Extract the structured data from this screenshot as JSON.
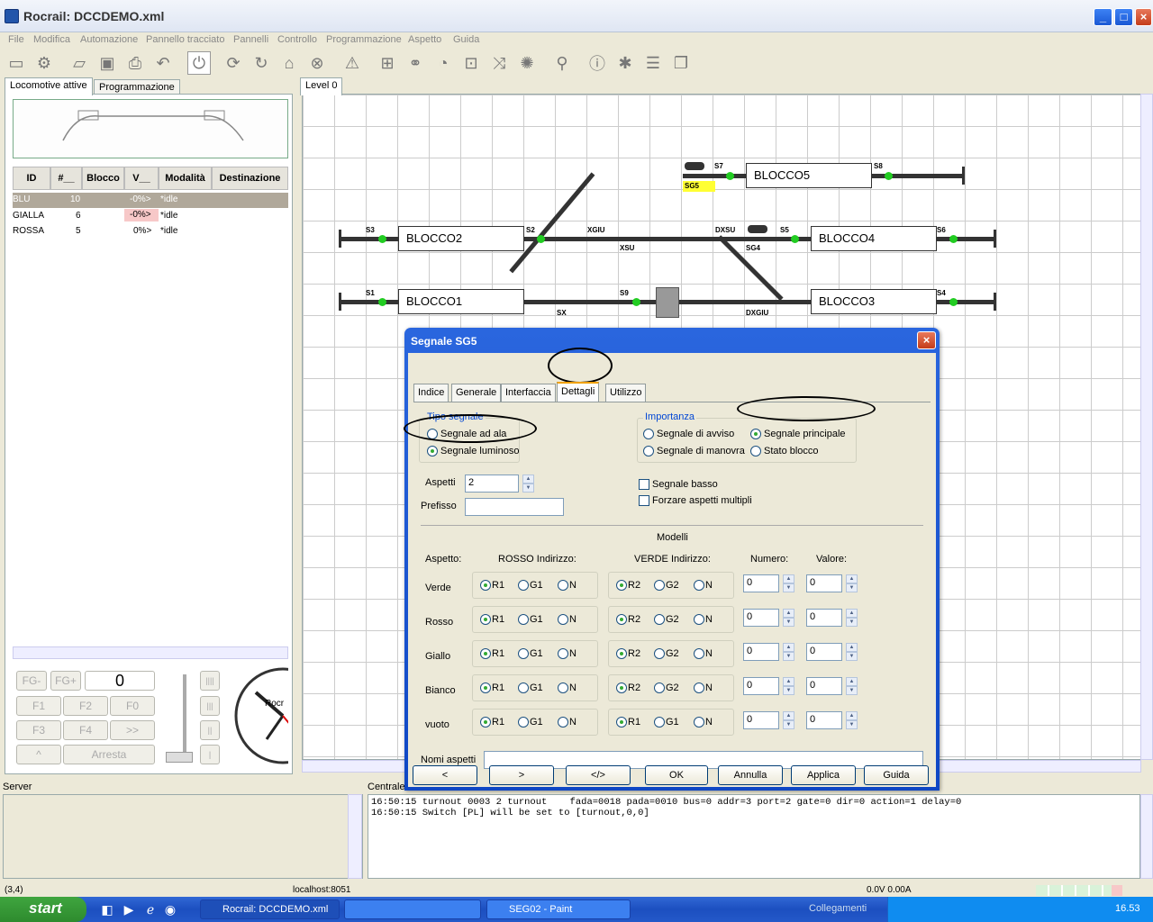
{
  "window": {
    "title": "Rocrail: DCCDEMO.xml"
  },
  "menu": [
    "File",
    "Modifica",
    "Automazione",
    "Pannello tracciato",
    "Pannelli",
    "Controllo",
    "Programmazione",
    "Aspetto",
    "Guida"
  ],
  "left_tabs": [
    "Locomotive attive",
    "Programmazione"
  ],
  "loco_table": {
    "headers": [
      "ID",
      "#__",
      "Blocco",
      "V__",
      "Modalità",
      "Destinazione"
    ],
    "rows": [
      {
        "id": "BLU",
        "num": "10",
        "blocco": "",
        "v": "-0%>",
        "mode": "*idle",
        "dest": ""
      },
      {
        "id": "GIALLA",
        "num": "6",
        "blocco": "",
        "v": "-0%>",
        "mode": "*idle",
        "dest": ""
      },
      {
        "id": "ROSSA",
        "num": "5",
        "blocco": "",
        "v": "0%>",
        "mode": "*idle",
        "dest": ""
      }
    ]
  },
  "controls": {
    "fg": "FG-",
    "fgplus": "FG+",
    "speed": "0",
    "f1": "F1",
    "f2": "F2",
    "f0": "F0",
    "f3": "F3",
    "f4": "F4",
    "more": ">>",
    "up": "^",
    "stop": "Arresta",
    "l4": "||||",
    "l3": "|||",
    "l2": "||",
    "l1": "|",
    "clock": "Rocr"
  },
  "canvas": {
    "level_tab": "Level 0",
    "blocks": [
      "BLOCCO5",
      "BLOCCO2",
      "BLOCCO4",
      "BLOCCO1",
      "BLOCCO3"
    ],
    "labels": {
      "s7": "S7",
      "s8": "S8",
      "sg5": "SG5",
      "s3": "S3",
      "s2": "S2",
      "xgiu": "XGIU",
      "xsu": "XSU",
      "dxsu": "DXSU",
      "s5": "S5",
      "sg4": "SG4",
      "s6": "S6",
      "s1": "S1",
      "sx": "SX",
      "s9": "S9",
      "dxgiu": "DXGIU",
      "s4": "S4"
    }
  },
  "dialog": {
    "title": "Segnale SG5",
    "tabs": [
      "Indice",
      "Generale",
      "Interfaccia",
      "Dettagli",
      "Utilizzo"
    ],
    "tipo_segnale": {
      "label": "Tipo segnale",
      "opt1": "Segnale ad ala",
      "opt2": "Segnale luminoso"
    },
    "importanza": {
      "label": "Importanza",
      "opt1": "Segnale di avviso",
      "opt2": "Segnale principale",
      "opt3": "Segnale di manovra",
      "opt4": "Stato blocco"
    },
    "aspetti_label": "Aspetti",
    "aspetti_value": "2",
    "prefisso_label": "Prefisso",
    "prefisso_value": "",
    "segnale_basso": "Segnale basso",
    "forzare": "Forzare aspetti multipli",
    "modelli": "Modelli",
    "col_aspetto": "Aspetto:",
    "col_rosso": "ROSSO Indirizzo:",
    "col_verde": "VERDE Indirizzo:",
    "col_numero": "Numero:",
    "col_valore": "Valore:",
    "rows": [
      {
        "name": "Verde",
        "r": [
          "R1",
          "G1",
          "N"
        ],
        "g": [
          "R2",
          "G2",
          "N"
        ],
        "num": "0",
        "val": "0"
      },
      {
        "name": "Rosso",
        "r": [
          "R1",
          "G1",
          "N"
        ],
        "g": [
          "R2",
          "G2",
          "N"
        ],
        "num": "0",
        "val": "0"
      },
      {
        "name": "Giallo",
        "r": [
          "R1",
          "G1",
          "N"
        ],
        "g": [
          "R2",
          "G2",
          "N"
        ],
        "num": "0",
        "val": "0"
      },
      {
        "name": "Bianco",
        "r": [
          "R1",
          "G1",
          "N"
        ],
        "g": [
          "R2",
          "G2",
          "N"
        ],
        "num": "0",
        "val": "0"
      },
      {
        "name": "vuoto",
        "r": [
          "R1",
          "G1",
          "N"
        ],
        "g": [
          "R1",
          "G1",
          "N"
        ],
        "num": "0",
        "val": "0"
      }
    ],
    "nomi_aspetti": "Nomi aspetti",
    "buttons": {
      "prev": "<",
      "next": ">",
      "xml": "</>",
      "ok": "OK",
      "cancel": "Annulla",
      "apply": "Applica",
      "help": "Guida"
    }
  },
  "bottom": {
    "server": "Server",
    "centrale": "Centrale",
    "log": [
      "16:50:15 turnout 0003 2 turnout    fada=0018 pada=0010 bus=0 addr=3 port=2 gate=0 dir=0 action=1 delay=0",
      "16:50:15 Switch [PL] will be set to [turnout,0,0]"
    ]
  },
  "status": {
    "coords": "(3,4)",
    "host": "localhost:8051",
    "volt": "0.0V 0.00A"
  },
  "taskbar": {
    "start": "start",
    "task1": "Rocrail: DCCDEMO.xml",
    "task2": "SEG02 - Paint",
    "links": "Collegamenti",
    "time": "16.53"
  }
}
